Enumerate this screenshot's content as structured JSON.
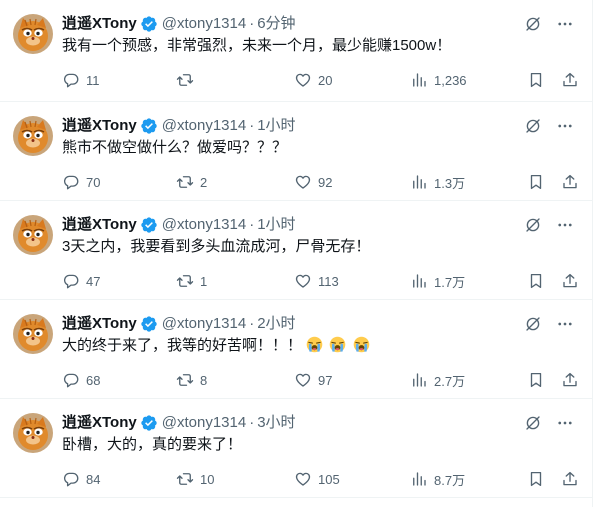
{
  "colors": {
    "text": "#0f1419",
    "secondary": "#536471",
    "verified_badge": "#1d9bf0",
    "divider": "#eff3f4"
  },
  "icons": [
    "avatar-cat",
    "verified-badge-icon",
    "grok-icon",
    "more-icon",
    "reply-icon",
    "retweet-icon",
    "like-icon",
    "views-icon",
    "bookmark-icon",
    "share-icon",
    "loudly-crying-face-emoji"
  ],
  "tweets": [
    {
      "name": "逍遥XTony",
      "handle": "@xtony1314",
      "dot": "·",
      "time": "6分钟",
      "text": "我有一个预感，非常强烈，未来一个月，最少能赚1500w！",
      "emoji_count": 0,
      "replies": "11",
      "retweets": "",
      "likes": "20",
      "views": "1,236"
    },
    {
      "name": "逍遥XTony",
      "handle": "@xtony1314",
      "dot": "·",
      "time": "1小时",
      "text": "熊市不做空做什么？做爱吗？？？",
      "emoji_count": 0,
      "replies": "70",
      "retweets": "2",
      "likes": "92",
      "views": "1.3万"
    },
    {
      "name": "逍遥XTony",
      "handle": "@xtony1314",
      "dot": "·",
      "time": "1小时",
      "text": "3天之内，我要看到多头血流成河，尸骨无存！",
      "emoji_count": 0,
      "replies": "47",
      "retweets": "1",
      "likes": "113",
      "views": "1.7万"
    },
    {
      "name": "逍遥XTony",
      "handle": "@xtony1314",
      "dot": "·",
      "time": "2小时",
      "text": "大的终于来了，我等的好苦啊！！！",
      "emoji_count": 3,
      "replies": "68",
      "retweets": "8",
      "likes": "97",
      "views": "2.7万"
    },
    {
      "name": "逍遥XTony",
      "handle": "@xtony1314",
      "dot": "·",
      "time": "3小时",
      "text": "卧槽，大的，真的要来了！",
      "emoji_count": 0,
      "replies": "84",
      "retweets": "10",
      "likes": "105",
      "views": "8.7万"
    }
  ]
}
